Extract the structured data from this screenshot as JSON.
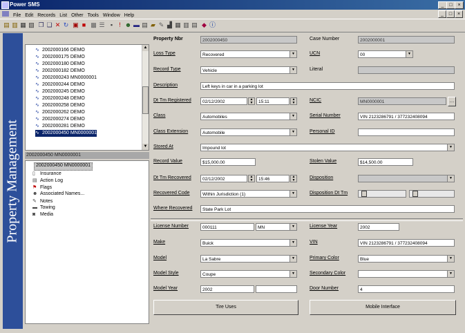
{
  "window": {
    "title": "Power SMS"
  },
  "menu": [
    "File",
    "Edit",
    "Records",
    "List",
    "Other",
    "Tools",
    "Window",
    "Help"
  ],
  "tree": {
    "items": [
      "2002000166 DEMO",
      "2002000175 DEMO",
      "2002000180 DEMO",
      "2002000182 DEMO",
      "2002000243 MN0000001",
      "2002000244 DEMO",
      "2002000245 DEMO",
      "2002000248 DEMO",
      "2002000258 DEMO",
      "2002000262 DEMO",
      "2002000274 DEMO",
      "2002000281 DEMO",
      "2002000450 MN0000001"
    ],
    "selected_index": 12,
    "header": "2002000450 MN0000001"
  },
  "subtree": {
    "root": "2002000450 MN0000001",
    "items": [
      "Insurance",
      "Action Log",
      "Flags",
      "Associated Names...",
      "Notes",
      "Towing",
      "Media"
    ]
  },
  "sidebar": {
    "label": "Property Management"
  },
  "form": {
    "property_nbr": {
      "label": "Property Nbr",
      "value": "2002000450"
    },
    "case_number": {
      "label": "Case Number",
      "value": "2002000001"
    },
    "loss_type": {
      "label": "Loss Type",
      "value": "Recovered"
    },
    "ucr": {
      "label": "UCN",
      "value": "00"
    },
    "record_type": {
      "label": "Record Type",
      "value": "Vehicle"
    },
    "literal": {
      "label": "Literal",
      "value": ""
    },
    "description": {
      "label": "Description",
      "value": "Left keys in car in a parking lot"
    },
    "dt_registered": {
      "label": "Dt Tm Registered",
      "date": "02/12/2002",
      "time": "15:11"
    },
    "ncic": {
      "label": "NCIC",
      "value": "MN0000001"
    },
    "class": {
      "label": "Class",
      "value": "Automobiles"
    },
    "serial_number": {
      "label": "Serial Number",
      "value": "VIN 2123286791 / 377232408094"
    },
    "class_extension": {
      "label": "Class Extension",
      "value": "Automobile"
    },
    "personal_id": {
      "label": "Personal ID",
      "value": ""
    },
    "stored_at": {
      "label": "Stored At",
      "value": "Impound lot"
    },
    "record_value": {
      "label": "Record Value",
      "value": "$15,000.00"
    },
    "stolen_value": {
      "label": "Stolen Value",
      "value": "$14,500.00"
    },
    "dt_recovered": {
      "label": "Dt Tm Recovered",
      "date": "02/12/2002",
      "time": "15:46"
    },
    "disposition": {
      "label": "Disposition",
      "value": ""
    },
    "recovered_code": {
      "label": "Recovered Code",
      "value": "Within Jurisdiction (1)"
    },
    "disposition_dt": {
      "label": "Disposition Dt Tm",
      "value": ""
    },
    "where_recovered": {
      "label": "Where Recovered",
      "value": "State Park Lot"
    },
    "license_number": {
      "label": "License Number",
      "value": "000111",
      "state": "MN"
    },
    "license_year": {
      "label": "License Year",
      "value": "2002"
    },
    "make": {
      "label": "Make",
      "value": "Buick"
    },
    "vin": {
      "label": "VIN",
      "value": "VIN 2123286791 / 377232408094"
    },
    "model": {
      "label": "Model",
      "value": "La Sabre"
    },
    "primary_color": {
      "label": "Primary Color",
      "value": "Blue"
    },
    "model_style": {
      "label": "Model Style",
      "value": "Coupe"
    },
    "secondary_color": {
      "label": "Secondary Color",
      "value": ""
    },
    "model_year": {
      "label": "Model Year",
      "value": "2002"
    },
    "door_number": {
      "label": "Door Number",
      "value": "4"
    }
  },
  "buttons": {
    "tireuses": "Tire Uses",
    "mobile": "Mobile Interface"
  },
  "colors": {
    "sidebar": "#2d4f9a",
    "titlebar": "#0a246a",
    "selection": "#0a246a"
  }
}
